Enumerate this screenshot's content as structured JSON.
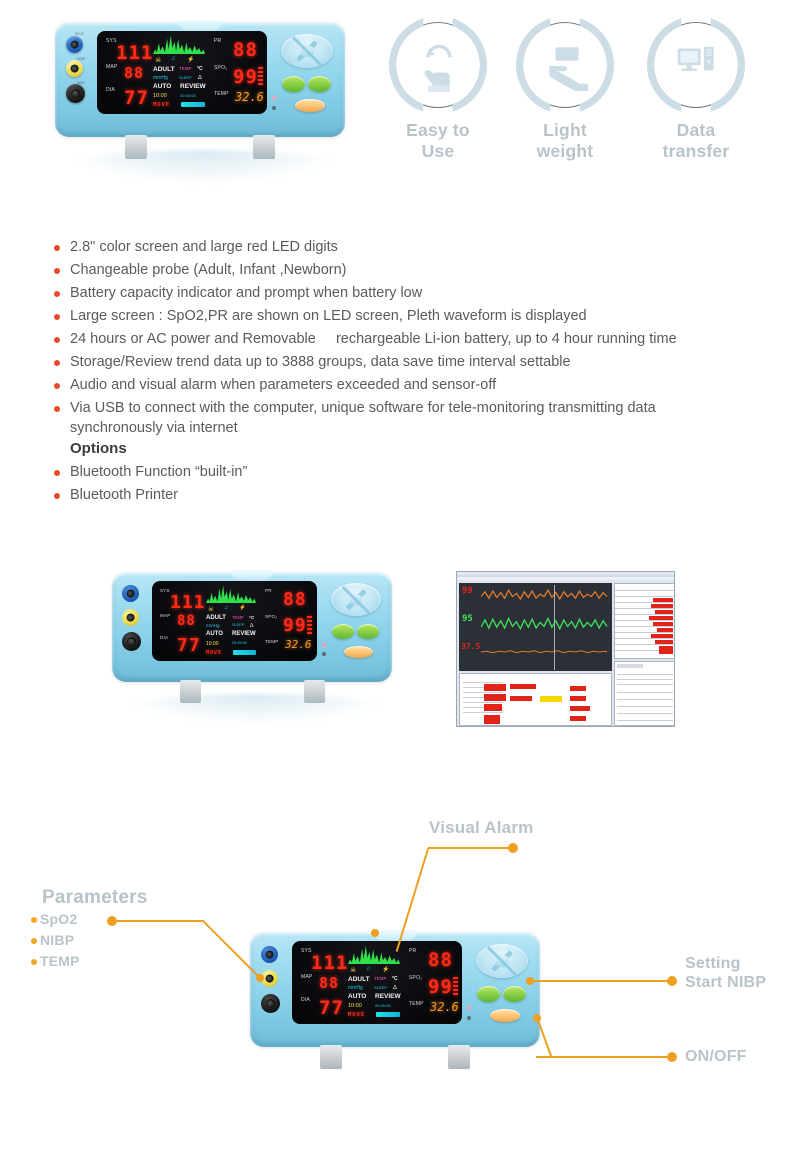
{
  "features": [
    {
      "label": "Easy to Use",
      "icon": "touch-hand-icon"
    },
    {
      "label": "Light weight",
      "icon": "hand-holding-device-icon"
    },
    {
      "label": "Data transfer",
      "icon": "monitor-pc-icon"
    }
  ],
  "bullets": [
    "2.8\" color screen and large red LED digits",
    "Changeable probe (Adult, Infant ,Newborn)",
    "Battery capacity indicator and prompt when battery low",
    "Large screen : SpO2,PR are shown on LED screen, Pleth waveform is displayed",
    "24 hours or AC power and Removable     rechargeable Li-ion battery, up to 4 hour running time",
    "Storage/Review trend data up to 3888 groups, data save time interval settable",
    "Audio and visual alarm when parameters exceeded and sensor-off"
  ],
  "bullet_wrapped": "Via USB to connect with the computer, unique software for tele-monitoring  transmitting data synchronously via internet",
  "options_heading": "Options",
  "options": [
    "Bluetooth Function “built-in”",
    "Bluetooth Printer"
  ],
  "device_screen": {
    "sys_label": "SYS",
    "sys_value": "111",
    "map_label": "MAP",
    "map_value": "88",
    "dia_label": "DIA",
    "dia_value": "77",
    "pr_label": "PR",
    "pr_value": "88",
    "spo2_label": "SPO₂",
    "spo2_value": "99",
    "temp_label": "TEMP",
    "temp_value": "32.6",
    "mode_patient": "ADULT",
    "unit": "mmHg",
    "mode_auto": "AUTO",
    "timer": "10:00",
    "move": "MOVE",
    "temp_unit_label": "TEMP",
    "temp_unit": "°C",
    "sleep_label": "SLEEP",
    "review": "REVIEW",
    "status": "00:45:08"
  },
  "device_ports": [
    {
      "name": "SPO2",
      "color": "#1f5fb8"
    },
    {
      "name": "TEMP",
      "color": "#ecd94a"
    },
    {
      "name": "NIBP",
      "color": "#1a1a1a"
    }
  ],
  "annotations": {
    "visual_alarm": "Visual Alarm",
    "parameters_heading": "Parameters",
    "parameters": [
      "SpO2",
      "NIBP",
      "TEMP"
    ],
    "setting_line1": "Setting",
    "setting_line2": "Start NIBP",
    "on_off": "ON/OFF"
  },
  "colors": {
    "accent_orange": "#eda020",
    "bullet_red": "#e8472a",
    "label_gray": "#b9c3ca",
    "device_blue": "#9fdcf1",
    "led_red": "#ff2b16",
    "led_orange": "#ff9a1f",
    "waveform_green": "#2fe04a"
  }
}
